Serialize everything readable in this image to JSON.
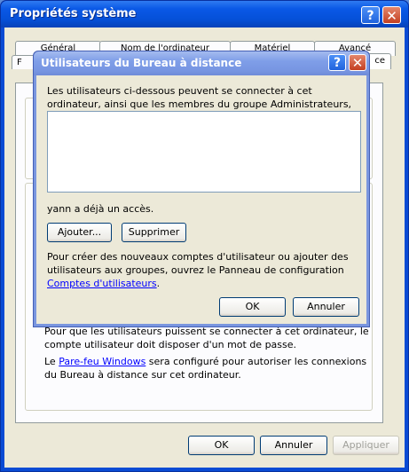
{
  "window": {
    "title": "Propriétés système",
    "help_glyph": "?",
    "close_glyph": "✕"
  },
  "tabs": [
    {
      "label": "Général"
    },
    {
      "label": "Nom de l'ordinateur"
    },
    {
      "label": "Matériel"
    },
    {
      "label": "Avancé"
    },
    {
      "label": "F"
    },
    {
      "label": "ce"
    }
  ],
  "panel": {
    "requirement_text": "Pour que les utilisateurs puissent se connecter à cet ordinateur, le compte utilisateur doit disposer d'un mot de passe.",
    "firewall_before": "Le ",
    "firewall_link": "Pare-feu Windows",
    "firewall_after": " sera configuré pour autoriser les connexions du Bureau à distance sur cet ordinateur."
  },
  "footer": {
    "ok": "OK",
    "cancel": "Annuler",
    "apply": "Appliquer"
  },
  "dialog": {
    "title": "Utilisateurs du Bureau à distance",
    "help_glyph": "?",
    "close_glyph": "✕",
    "intro": "Les utilisateurs ci-dessous peuvent se connecter à cet ordinateur, ainsi que les membres du groupe Administrateurs, même s'ils n'apparaissent pas ici.",
    "user_list": [],
    "access_note": "yann a déjà un accès.",
    "add_button": "Ajouter...",
    "remove_button": "Supprimer",
    "info_before": "Pour créer des nouveaux comptes d'utilisateur ou ajouter des utilisateurs aux groupes, ouvrez le Panneau de configuration ",
    "info_link": "Comptes d'utilisateurs",
    "info_after": ".",
    "ok": "OK",
    "cancel": "Annuler"
  },
  "colors": {
    "titlebar_blue": "#0a58e6",
    "dialog_title_blue": "#7f9ee8",
    "face": "#ece9d8",
    "link": "#0000ff"
  }
}
